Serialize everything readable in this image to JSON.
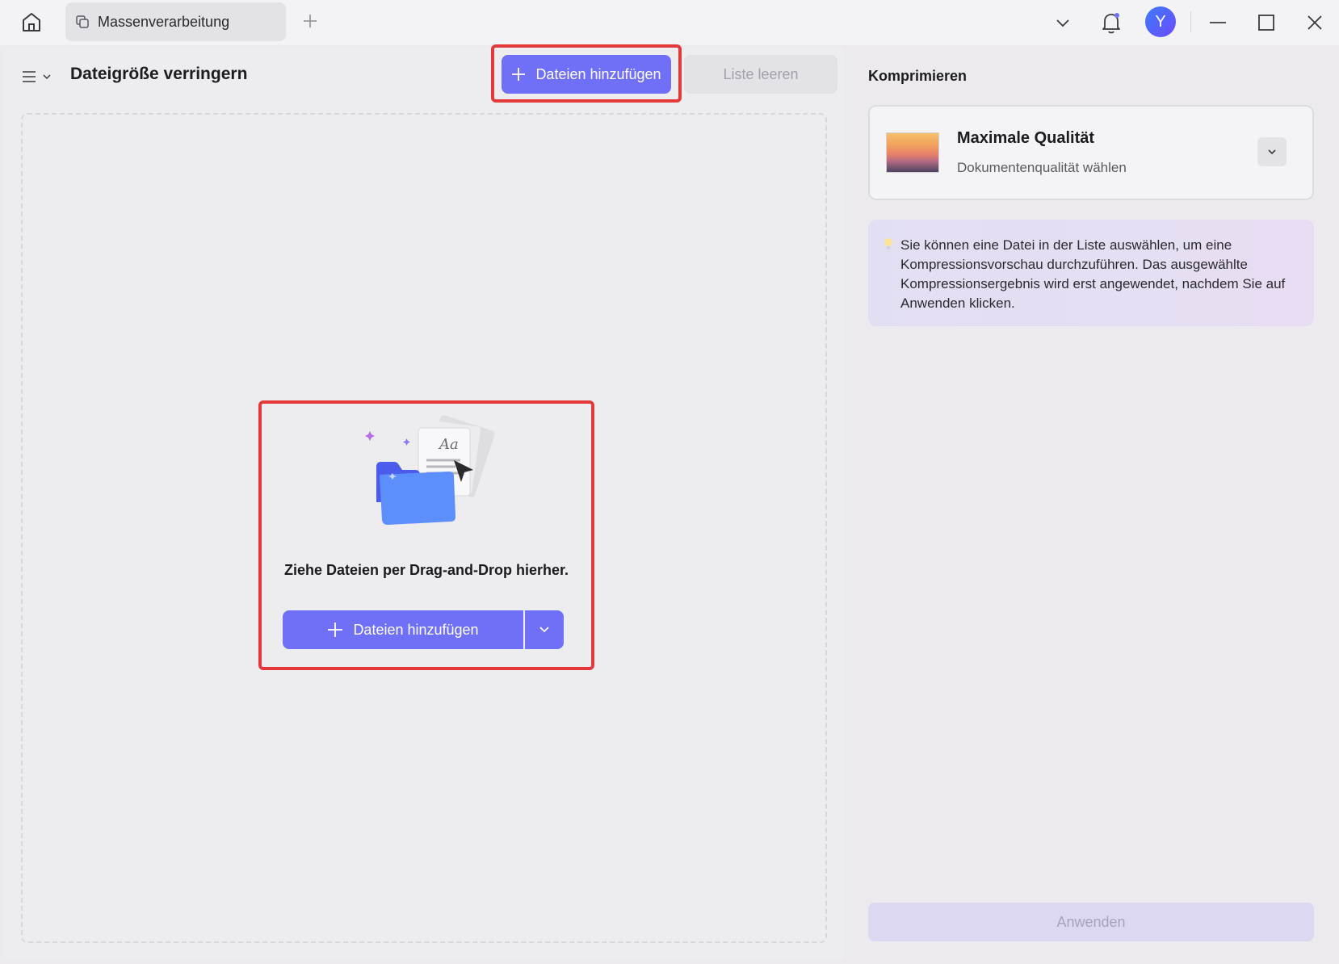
{
  "titlebar": {
    "tab_label": "Massenverarbeitung",
    "avatar_initial": "Y"
  },
  "toolbar": {
    "page_title": "Dateigröße verringern",
    "add_files_label": "Dateien hinzufügen",
    "clear_list_label": "Liste leeren"
  },
  "dropzone": {
    "instruction": "Ziehe Dateien per Drag-and-Drop hierher.",
    "add_files_label": "Dateien hinzufügen"
  },
  "compress": {
    "section_title": "Komprimieren",
    "quality_title": "Maximale Qualität",
    "quality_subtitle": "Dokumentenqualität wählen",
    "info_text": "Sie können eine Datei in der Liste auswählen, um eine Kompressionsvorschau durchzuführen. Das ausgewählte Kompressionsergebnis wird erst angewendet, nachdem Sie auf Anwenden klicken.",
    "apply_label": "Anwenden"
  },
  "icons": {
    "home": "home-icon",
    "tab": "tab-copy-icon",
    "new_tab": "plus-icon",
    "dropdown": "chevron-down-icon",
    "notifications": "bell-icon",
    "minimize": "minimize-icon",
    "maximize": "maximize-icon",
    "close": "close-icon",
    "menu": "hamburger-icon",
    "bulb": "lightbulb-icon"
  },
  "colors": {
    "accent": "#6f6ff8",
    "highlight_border": "#e3393b",
    "avatar": "#4a6cff"
  }
}
